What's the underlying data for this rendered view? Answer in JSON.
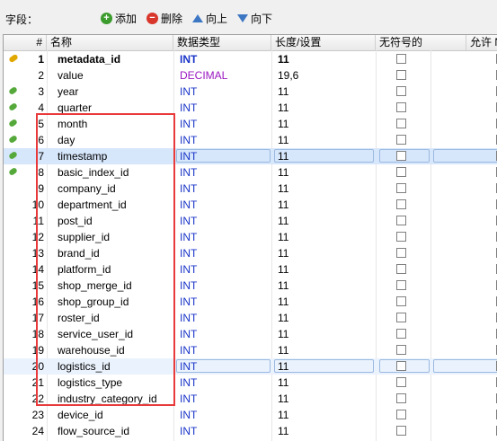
{
  "toolbar": {
    "label": "字段：",
    "add": "添加",
    "delete": "删除",
    "up": "向上",
    "down": "向下"
  },
  "headers": {
    "num": "#",
    "name": "名称",
    "type": "数据类型",
    "length": "长度/设置",
    "unsigned": "无符号的",
    "allow_null": "允许 N"
  },
  "rows": [
    {
      "num": "1",
      "name": "metadata_id",
      "type": "INT",
      "length": "11",
      "key": "primary"
    },
    {
      "num": "2",
      "name": "value",
      "type": "DECIMAL",
      "length": "19,6",
      "key": ""
    },
    {
      "num": "3",
      "name": "year",
      "type": "INT",
      "length": "11",
      "key": "index"
    },
    {
      "num": "4",
      "name": "quarter",
      "type": "INT",
      "length": "11",
      "key": "index"
    },
    {
      "num": "5",
      "name": "month",
      "type": "INT",
      "length": "11",
      "key": "index"
    },
    {
      "num": "6",
      "name": "day",
      "type": "INT",
      "length": "11",
      "key": "index"
    },
    {
      "num": "7",
      "name": "timestamp",
      "type": "INT",
      "length": "11",
      "key": "index"
    },
    {
      "num": "8",
      "name": "basic_index_id",
      "type": "INT",
      "length": "11",
      "key": "index"
    },
    {
      "num": "9",
      "name": "company_id",
      "type": "INT",
      "length": "11",
      "key": ""
    },
    {
      "num": "10",
      "name": "department_id",
      "type": "INT",
      "length": "11",
      "key": ""
    },
    {
      "num": "11",
      "name": "post_id",
      "type": "INT",
      "length": "11",
      "key": ""
    },
    {
      "num": "12",
      "name": "supplier_id",
      "type": "INT",
      "length": "11",
      "key": ""
    },
    {
      "num": "13",
      "name": "brand_id",
      "type": "INT",
      "length": "11",
      "key": ""
    },
    {
      "num": "14",
      "name": "platform_id",
      "type": "INT",
      "length": "11",
      "key": ""
    },
    {
      "num": "15",
      "name": "shop_merge_id",
      "type": "INT",
      "length": "11",
      "key": ""
    },
    {
      "num": "16",
      "name": "shop_group_id",
      "type": "INT",
      "length": "11",
      "key": ""
    },
    {
      "num": "17",
      "name": "roster_id",
      "type": "INT",
      "length": "11",
      "key": ""
    },
    {
      "num": "18",
      "name": "service_user_id",
      "type": "INT",
      "length": "11",
      "key": ""
    },
    {
      "num": "19",
      "name": "warehouse_id",
      "type": "INT",
      "length": "11",
      "key": ""
    },
    {
      "num": "20",
      "name": "logistics_id",
      "type": "INT",
      "length": "11",
      "key": ""
    },
    {
      "num": "21",
      "name": "logistics_type",
      "type": "INT",
      "length": "11",
      "key": ""
    },
    {
      "num": "22",
      "name": "industry_category_id",
      "type": "INT",
      "length": "11",
      "key": ""
    },
    {
      "num": "23",
      "name": "device_id",
      "type": "INT",
      "length": "11",
      "key": ""
    },
    {
      "num": "24",
      "name": "flow_source_id",
      "type": "INT",
      "length": "11",
      "key": ""
    }
  ],
  "colors": {
    "highlight_box": "#e8393b",
    "type_text": "#1a35c8",
    "decimal_text": "#9a17c1"
  }
}
